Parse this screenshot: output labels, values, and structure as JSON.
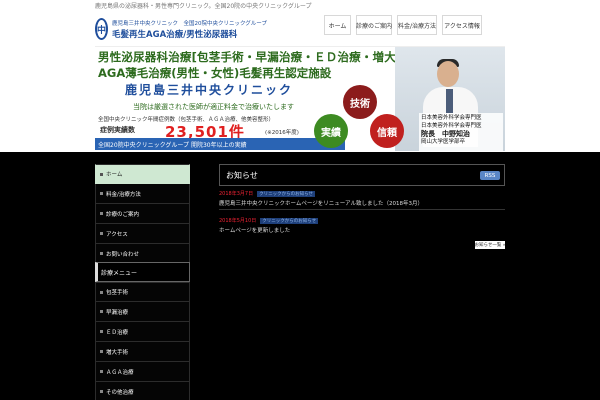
{
  "topbar": {
    "text": "鹿児島県の泌尿器科・男性専門クリニック。全国20院の中央クリニックグループ"
  },
  "header": {
    "logo_mark": "中",
    "logo_small": "鹿児島三井中央クリニック　全国20院中央クリニックグループ",
    "logo_big": "毛髪再生AGA治療/男性泌尿器科"
  },
  "nav": {
    "items": [
      {
        "label": "ホーム"
      },
      {
        "label": "診療のご案内"
      },
      {
        "label": "料金/治療方法"
      },
      {
        "label": "アクセス情報"
      }
    ]
  },
  "banner": {
    "line1": "男性泌尿器科治療[包茎手術・早漏治療・ＥＤ治療・増大術等]",
    "line2": "AGA薄毛治療(男性・女性)毛髪再生認定施設",
    "clinic": "鹿児島三井中央クリニック",
    "note": "当院は厳選された医師が適正料金で治療いたします",
    "note2": "全国中央クリニック年間症例数（包茎手術、ＡＧＡ治療、他美容整形）",
    "count_label": "症例実績数",
    "count": "23,501件",
    "count_year": "(※2016年度)",
    "footer": "全国20院中央クリニックグループ  開院30年以上の実績",
    "circles": {
      "tech": "技術",
      "record": "実績",
      "trust": "信頼"
    },
    "doctor": {
      "cap1": "日本美容外科学会専門医",
      "cap2": "日本美容外科学会専門医",
      "name": "院長　中野知治",
      "cap3": "岡山大学医学部卒"
    }
  },
  "sidebar": {
    "menu": [
      {
        "label": "ホーム",
        "active": true
      },
      {
        "label": "料金/治療方法"
      },
      {
        "label": "診療のご案内"
      },
      {
        "label": "アクセス"
      },
      {
        "label": "お問い合わせ"
      }
    ],
    "section_title": "診療メニュー",
    "menu2": [
      {
        "label": "包茎手術"
      },
      {
        "label": "早漏治療"
      },
      {
        "label": "ＥＤ治療"
      },
      {
        "label": "増大手術"
      },
      {
        "label": "ＡＧＡ治療"
      },
      {
        "label": "その他治療"
      }
    ]
  },
  "news": {
    "title": "お知らせ",
    "rss": "RSS",
    "items": [
      {
        "date": "2018年3月7日",
        "category": "クリニックからのお知らせ",
        "text": "鹿児島三井中央クリニックホームページをリニューアル致しました（2018年3月）"
      },
      {
        "date": "2018年5月10日",
        "category": "クリニックからのお知らせ",
        "text": "ホームページを更新しました"
      }
    ],
    "more": "お知らせ一覧 »"
  },
  "colors": {
    "accent": "#2a64b4",
    "green": "#2d6b1e",
    "red": "#e02020",
    "dark_bg": "#000000"
  }
}
